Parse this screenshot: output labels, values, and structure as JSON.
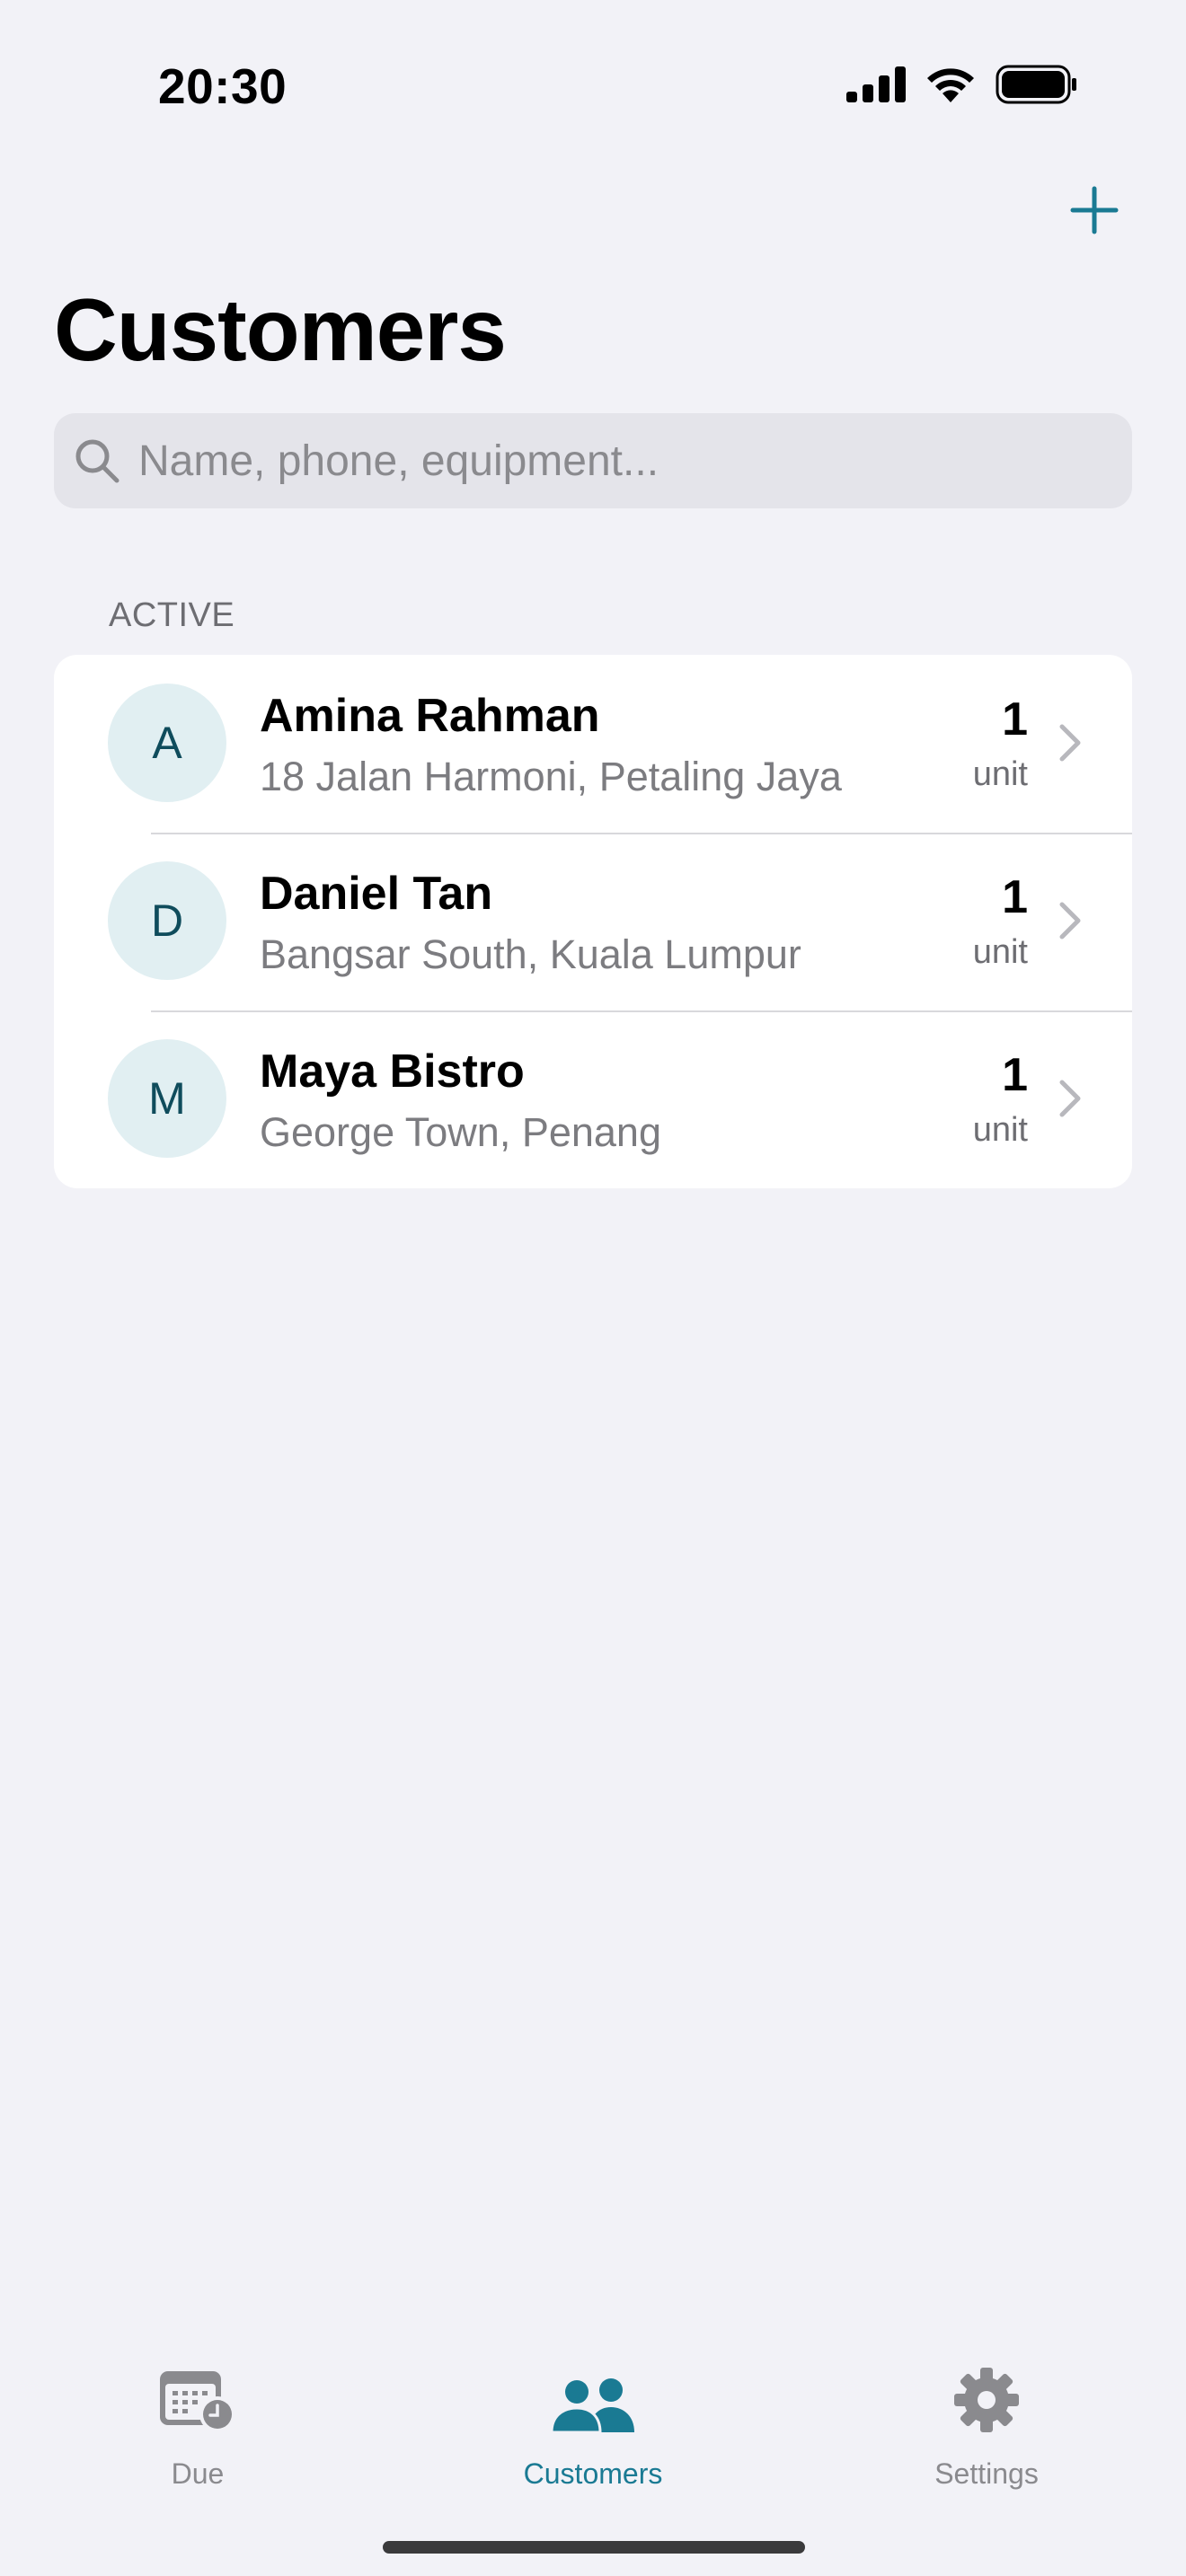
{
  "status_bar": {
    "time": "20:30"
  },
  "header": {
    "title": "Customers",
    "add_icon": "plus-icon"
  },
  "search": {
    "placeholder": "Name, phone, equipment...",
    "value": ""
  },
  "section": {
    "label": "ACTIVE"
  },
  "customers": [
    {
      "initial": "A",
      "name": "Amina Rahman",
      "address": "18 Jalan Harmoni, Petaling Jaya",
      "count": "1",
      "unit": "unit"
    },
    {
      "initial": "D",
      "name": "Daniel Tan",
      "address": "Bangsar South, Kuala Lumpur",
      "count": "1",
      "unit": "unit"
    },
    {
      "initial": "M",
      "name": "Maya Bistro",
      "address": "George Town, Penang",
      "count": "1",
      "unit": "unit"
    }
  ],
  "tab_bar": {
    "tabs": [
      {
        "label": "Due",
        "icon": "calendar-clock-icon",
        "active": false
      },
      {
        "label": "Customers",
        "icon": "people-icon",
        "active": true
      },
      {
        "label": "Settings",
        "icon": "gear-icon",
        "active": false
      }
    ]
  },
  "colors": {
    "accent": "#1a7a93",
    "background": "#f2f2f7",
    "avatar_bg": "#e1eff2",
    "avatar_text": "#0f4c5c"
  }
}
